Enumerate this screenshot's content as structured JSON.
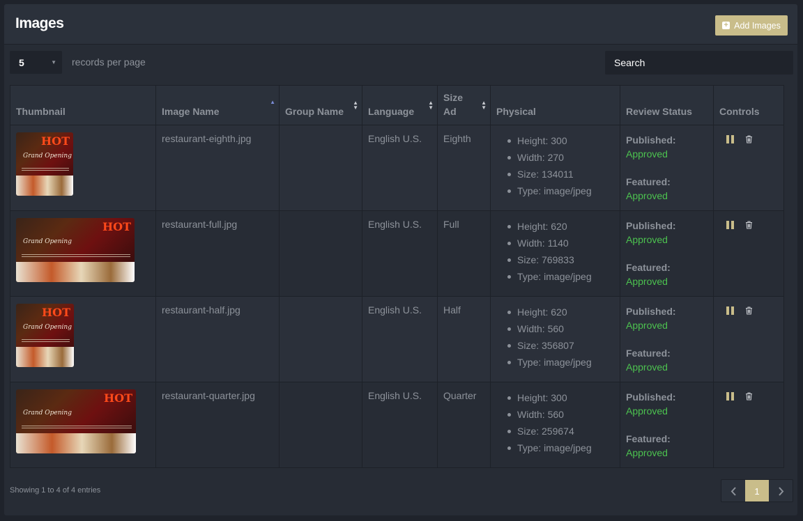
{
  "panel": {
    "title": "Images",
    "add_button_label": "Add Images"
  },
  "toolbar": {
    "per_page_value": "5",
    "per_page_label": "records per page",
    "search_placeholder": "Search"
  },
  "table": {
    "columns": [
      "Thumbnail",
      "Image Name",
      "Group Name",
      "Language",
      "Size Ad",
      "Physical",
      "Review Status",
      "Controls"
    ],
    "rows": [
      {
        "name": "restaurant-eighth.jpg",
        "group": "",
        "language": "English U.S.",
        "size_ad": "Eighth",
        "physical": [
          "Height: 300",
          "Width: 270",
          "Size: 134011",
          "Type: image/jpeg"
        ],
        "published_label": "Published:",
        "published_value": "Approved",
        "featured_label": "Featured:",
        "featured_value": "Approved",
        "thumb_hot": "HOT",
        "thumb_script": "Grand Opening"
      },
      {
        "name": "restaurant-full.jpg",
        "group": "",
        "language": "English U.S.",
        "size_ad": "Full",
        "physical": [
          "Height: 620",
          "Width: 1140",
          "Size: 769833",
          "Type: image/jpeg"
        ],
        "published_label": "Published:",
        "published_value": "Approved",
        "featured_label": "Featured:",
        "featured_value": "Approved",
        "thumb_hot": "HOT",
        "thumb_script": "Grand Opening"
      },
      {
        "name": "restaurant-half.jpg",
        "group": "",
        "language": "English U.S.",
        "size_ad": "Half",
        "physical": [
          "Height: 620",
          "Width: 560",
          "Size: 356807",
          "Type: image/jpeg"
        ],
        "published_label": "Published:",
        "published_value": "Approved",
        "featured_label": "Featured:",
        "featured_value": "Approved",
        "thumb_hot": "HOT",
        "thumb_script": "Grand Opening"
      },
      {
        "name": "restaurant-quarter.jpg",
        "group": "",
        "language": "English U.S.",
        "size_ad": "Quarter",
        "physical": [
          "Height: 300",
          "Width: 560",
          "Size: 259674",
          "Type: image/jpeg"
        ],
        "published_label": "Published:",
        "published_value": "Approved",
        "featured_label": "Featured:",
        "featured_value": "Approved",
        "thumb_hot": "HOT",
        "thumb_script": "Grand Opening"
      }
    ]
  },
  "footer": {
    "info": "Showing 1 to 4 of 4 entries",
    "pager": {
      "prev_icon": "chevron-left-icon",
      "current_page": "1",
      "next_icon": "chevron-right-icon"
    }
  },
  "colors": {
    "accent": "#c9bd8a",
    "approved": "#4cc24f",
    "sort_active": "#7b8cd6"
  }
}
